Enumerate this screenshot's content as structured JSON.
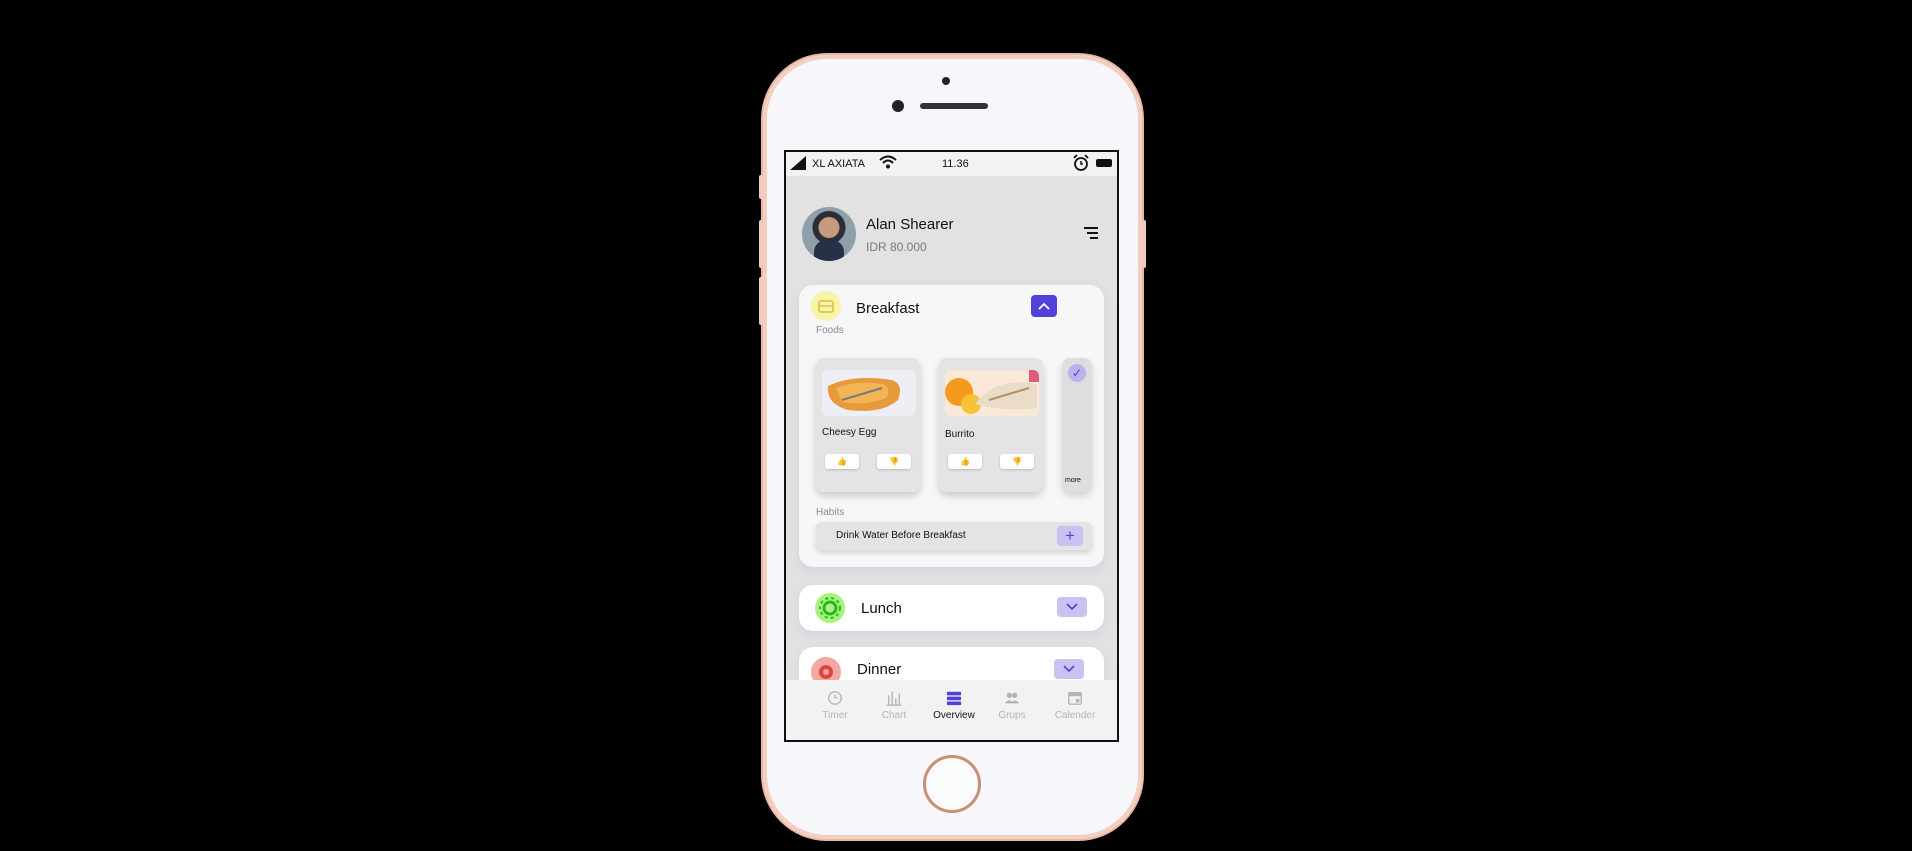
{
  "status": {
    "carrier": "XL AXIATA",
    "time": "11.36"
  },
  "user": {
    "name": "Alan Shearer",
    "balance": "IDR 80.000"
  },
  "breakfast": {
    "title": "Breakfast",
    "foods_label": "Foods",
    "foods": [
      {
        "name": "Cheesy Egg"
      },
      {
        "name": "Burrito"
      }
    ],
    "more_label": "more",
    "habits_label": "Habits",
    "habit": "Drink Water Before Breakfast"
  },
  "lunch": {
    "title": "Lunch"
  },
  "dinner": {
    "title": "Dinner"
  },
  "nav": [
    {
      "label": "Timer",
      "icon": "clock-icon"
    },
    {
      "label": "Chart",
      "icon": "bar-chart-icon"
    },
    {
      "label": "Overview",
      "icon": "list-icon"
    },
    {
      "label": "Grups",
      "icon": "people-icon"
    },
    {
      "label": "Calender",
      "icon": "calendar-icon"
    }
  ],
  "colors": {
    "accent": "#5141d8",
    "accent_soft": "#c9c2f3",
    "like": "#2fbf71",
    "dislike": "#e0463f"
  }
}
